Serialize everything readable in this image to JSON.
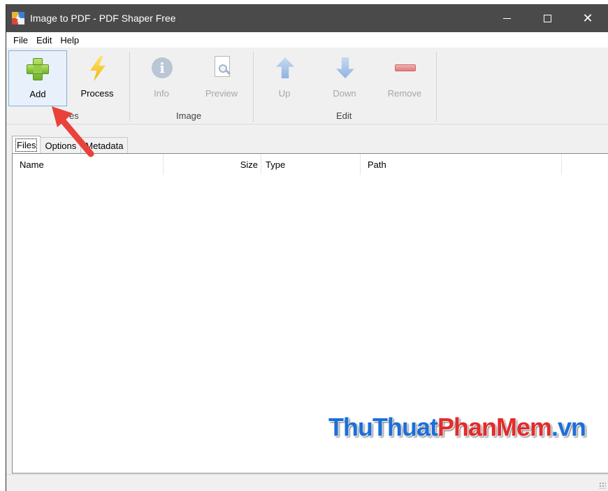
{
  "window": {
    "title": "Image to PDF - PDF Shaper Free",
    "controls": {
      "minimize": "—",
      "maximize": "☐",
      "close": "✕"
    }
  },
  "menu": {
    "items": [
      "File",
      "Edit",
      "Help"
    ]
  },
  "toolbar": {
    "add_label": "Add",
    "process_label": "Process",
    "info_label": "Info",
    "preview_label": "Preview",
    "up_label": "Up",
    "down_label": "Down",
    "remove_label": "Remove",
    "groups": {
      "files": "es",
      "image": "Image",
      "edit": "Edit"
    }
  },
  "tabs": [
    {
      "label": "Files",
      "active": true
    },
    {
      "label": "Options",
      "active": false
    },
    {
      "label": "Metadata",
      "active": false
    }
  ],
  "file_list": {
    "columns": [
      "Name",
      "Size",
      "Type",
      "Path"
    ],
    "rows": []
  },
  "watermark": {
    "part1": "ThuThuat",
    "part2": "PhanMem",
    "part3": ".vn"
  },
  "colors": {
    "titlebar": "#4a4a4a",
    "annotation_arrow": "#e8423a",
    "watermark_blue": "#1d6fd6",
    "watermark_red": "#e22b2b"
  }
}
